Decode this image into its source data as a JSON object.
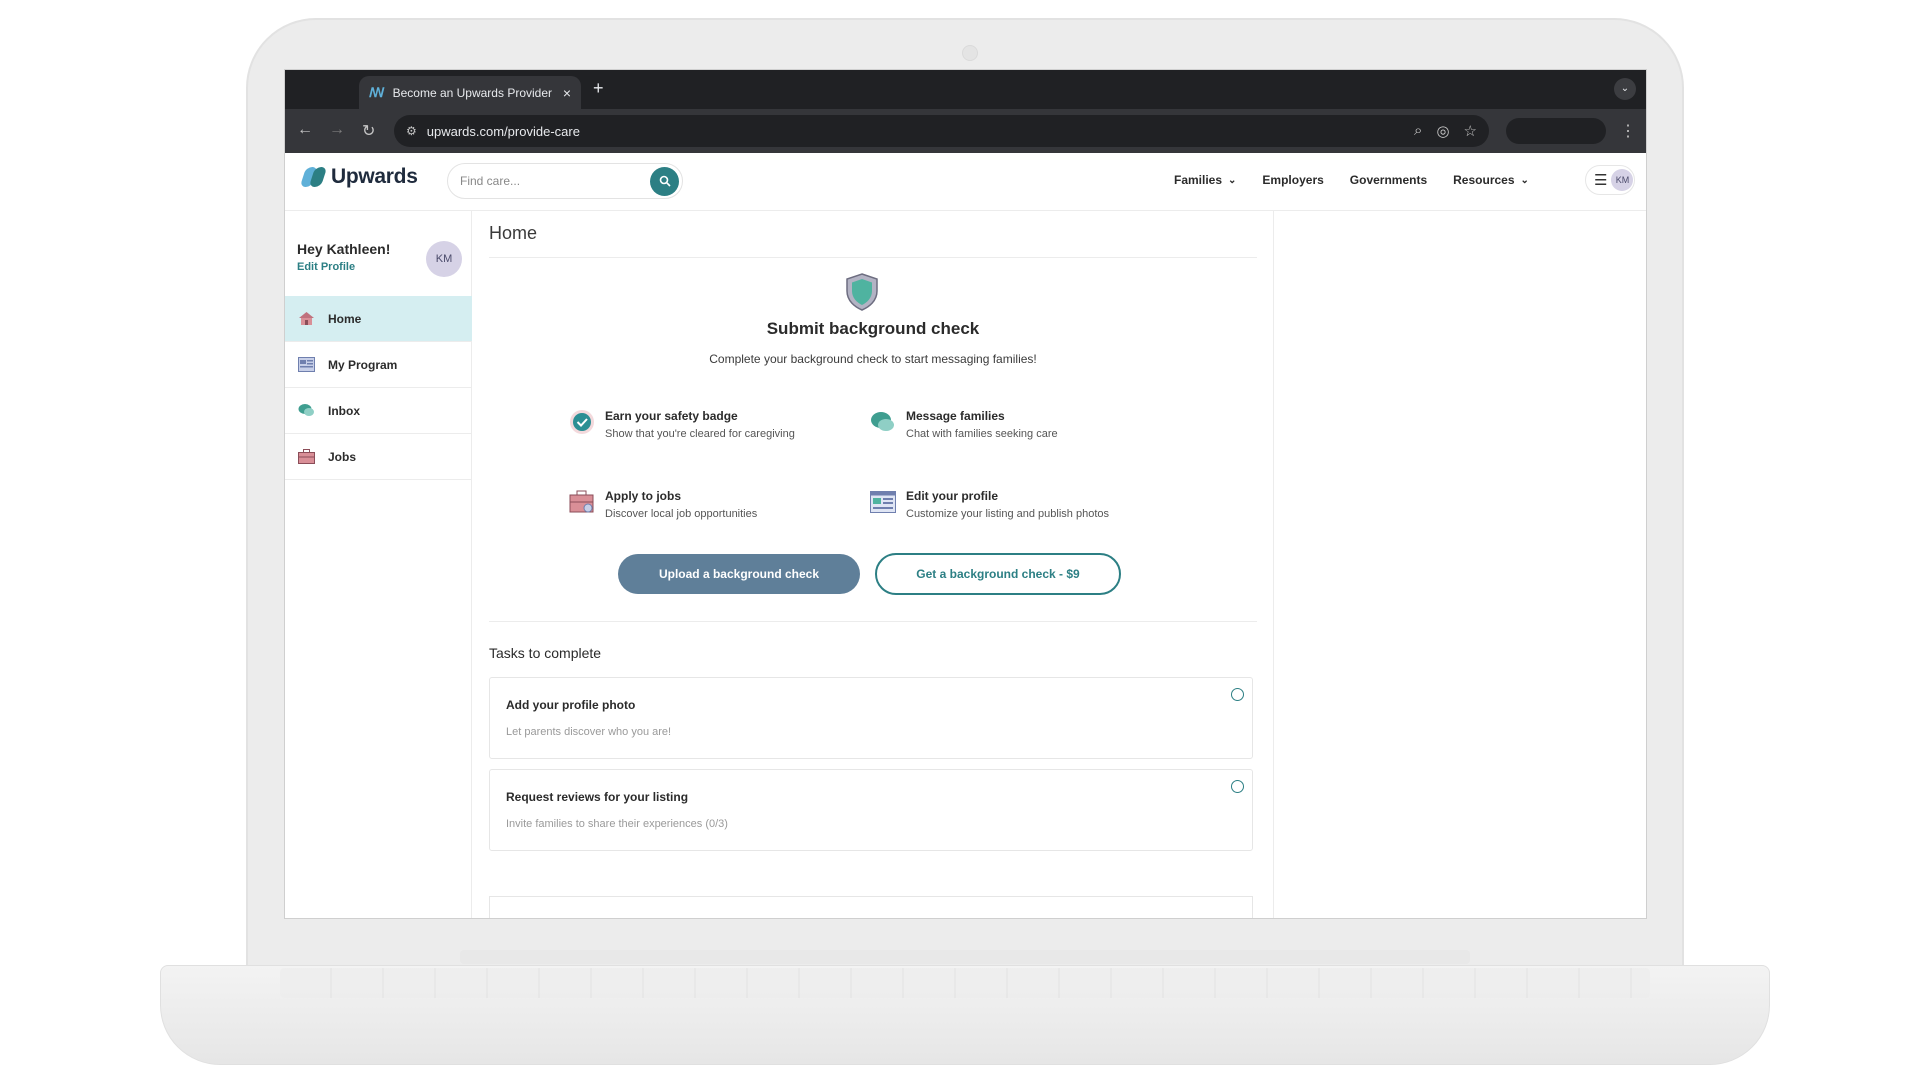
{
  "browser": {
    "tab_title": "Become an Upwards Provider",
    "tab_close": "×",
    "new_tab": "+",
    "url": "upwards.com/provide-care"
  },
  "header": {
    "logo_text": "Upwards",
    "search_placeholder": "Find care...",
    "nav": [
      "Families",
      "Employers",
      "Governments",
      "Resources"
    ],
    "user_initials": "KM"
  },
  "sidebar": {
    "greeting": "Hey Kathleen!",
    "edit_profile": "Edit Profile",
    "initials": "KM",
    "items": [
      {
        "label": "Home",
        "icon": "house-icon"
      },
      {
        "label": "My Program",
        "icon": "program-icon"
      },
      {
        "label": "Inbox",
        "icon": "chat-icon"
      },
      {
        "label": "Jobs",
        "icon": "briefcase-icon"
      }
    ]
  },
  "main": {
    "page_title": "Home",
    "bg_title": "Submit background check",
    "bg_subtitle": "Complete your background check to start messaging families!",
    "features": [
      {
        "title": "Earn your safety badge",
        "desc": "Show that you're cleared for caregiving",
        "icon": "check-badge-icon"
      },
      {
        "title": "Message families",
        "desc": "Chat with families seeking care",
        "icon": "chat-icon"
      },
      {
        "title": "Apply to jobs",
        "desc": "Discover local job opportunities",
        "icon": "briefcase-icon"
      },
      {
        "title": "Edit your profile",
        "desc": "Customize your listing and publish photos",
        "icon": "profile-card-icon"
      }
    ],
    "upload_button": "Upload a background check",
    "get_button": "Get a background check - $9",
    "tasks_title": "Tasks to complete",
    "tasks": [
      {
        "title": "Add your profile photo",
        "desc": "Let parents discover who you are!"
      },
      {
        "title": "Request reviews for your listing",
        "desc": "Invite families to share their experiences (0/3)"
      }
    ]
  },
  "colors": {
    "brand_teal": "#2c7f84",
    "active_nav_bg": "#d5eef1",
    "primary_button": "#5f7f99",
    "avatar_bg": "#d6d2e6"
  }
}
